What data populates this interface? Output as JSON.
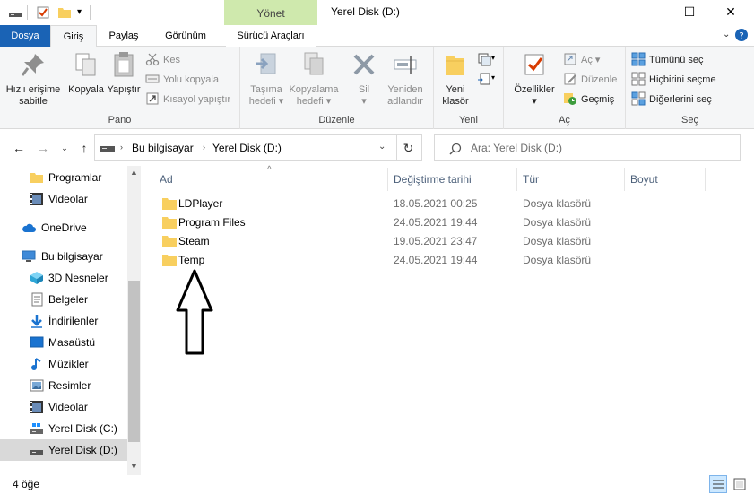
{
  "window": {
    "title": "Yerel Disk (D:)",
    "manage_tab": "Yönet",
    "controls": {
      "minimize": "—",
      "maximize": "☐",
      "close": "✕"
    }
  },
  "ribbon_tabs": [
    {
      "label": "Dosya"
    },
    {
      "label": "Giriş"
    },
    {
      "label": "Paylaş"
    },
    {
      "label": "Görünüm"
    },
    {
      "label": "Sürücü Araçları"
    }
  ],
  "ribbon": {
    "pano": {
      "label": "Pano",
      "pin": "Hızlı erişime sabitle",
      "pin_line1": "Hızlı erişime",
      "pin_line2": "sabitle",
      "copy": "Kopyala",
      "paste": "Yapıştır",
      "cut": "Kes",
      "copy_path": "Yolu kopyala",
      "paste_shortcut": "Kısayol yapıştır"
    },
    "duzenle": {
      "label": "Düzenle",
      "move_line1": "Taşıma",
      "move_line2": "hedefi",
      "copyto_line1": "Kopyalama",
      "copyto_line2": "hedefi",
      "delete": "Sil",
      "rename_line1": "Yeniden",
      "rename_line2": "adlandır"
    },
    "yeni": {
      "label": "Yeni",
      "new_folder_line1": "Yeni",
      "new_folder_line2": "klasör"
    },
    "ac": {
      "label": "Aç",
      "properties": "Özellikler",
      "open": "Aç",
      "edit": "Düzenle",
      "history": "Geçmiş"
    },
    "sec": {
      "label": "Seç",
      "select_all": "Tümünü seç",
      "select_none": "Hiçbirini seçme",
      "invert": "Diğerlerini seç"
    }
  },
  "address": {
    "crumbs": [
      "Bu bilgisayar",
      "Yerel Disk (D:)"
    ],
    "search_placeholder": "Ara: Yerel Disk (D:)"
  },
  "nav": {
    "items": [
      {
        "label": "Programlar",
        "icon": "folder-icon"
      },
      {
        "label": "Videolar",
        "icon": "video-icon"
      },
      {
        "label": "OneDrive",
        "icon": "cloud-icon"
      },
      {
        "label": "Bu bilgisayar",
        "icon": "computer-icon"
      },
      {
        "label": "3D Nesneler",
        "icon": "cube-icon"
      },
      {
        "label": "Belgeler",
        "icon": "document-icon"
      },
      {
        "label": "İndirilenler",
        "icon": "download-icon"
      },
      {
        "label": "Masaüstü",
        "icon": "desktop-icon"
      },
      {
        "label": "Müzikler",
        "icon": "music-icon"
      },
      {
        "label": "Resimler",
        "icon": "pictures-icon"
      },
      {
        "label": "Videolar",
        "icon": "video-icon"
      },
      {
        "label": "Yerel Disk (C:)",
        "icon": "drive-icon"
      },
      {
        "label": "Yerel Disk (D:)",
        "icon": "drive-icon"
      }
    ]
  },
  "columns": {
    "name": "Ad",
    "date": "Değiştirme tarihi",
    "type": "Tür",
    "size": "Boyut"
  },
  "files": [
    {
      "name": "LDPlayer",
      "date": "18.05.2021 00:25",
      "type": "Dosya klasörü"
    },
    {
      "name": "Program Files",
      "date": "24.05.2021 19:44",
      "type": "Dosya klasörü"
    },
    {
      "name": "Steam",
      "date": "19.05.2021 23:47",
      "type": "Dosya klasörü"
    },
    {
      "name": "Temp",
      "date": "24.05.2021 19:44",
      "type": "Dosya klasörü"
    }
  ],
  "status": {
    "count": "4 öğe"
  },
  "colors": {
    "file_tab": "#1a63b5",
    "manage_tab": "#cfe9ad",
    "folder": "#f8cf5f",
    "selected_nav": "#d9d9d9",
    "column_header": "#4c607a"
  }
}
